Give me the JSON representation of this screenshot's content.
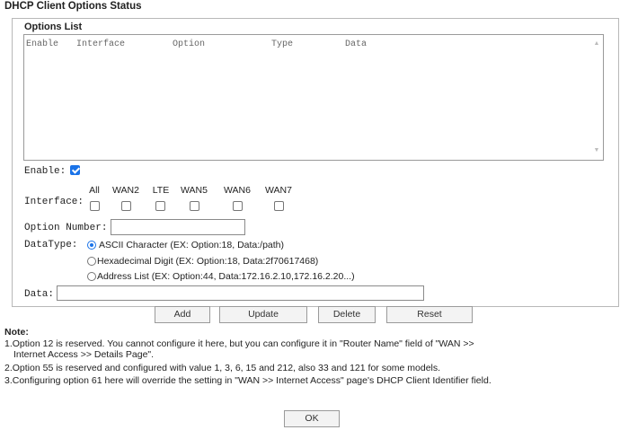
{
  "page": {
    "title": "DHCP Client Options Status"
  },
  "options_list": {
    "title": "Options List",
    "columns": [
      "Enable",
      "Interface",
      "Option",
      "Type",
      "Data"
    ]
  },
  "form": {
    "enable_label": "Enable:",
    "enable_checked": true,
    "interface_label": "Interface:",
    "interfaces": [
      "All",
      "WAN2",
      "LTE",
      "WAN5",
      "WAN6",
      "WAN7"
    ],
    "option_number_label": "Option Number:",
    "option_number_value": "",
    "datatype_label": "DataType:",
    "datatype_options": [
      {
        "label": "ASCII Character (EX: Option:18, Data:/path)",
        "selected": true
      },
      {
        "label": "Hexadecimal Digit (EX: Option:18, Data:2f70617468)",
        "selected": false
      },
      {
        "label": "Address List (EX: Option:44, Data:172.16.2.10,172.16.2.20...)",
        "selected": false
      }
    ],
    "data_label": "Data:",
    "data_value": ""
  },
  "buttons": {
    "add": "Add",
    "update": "Update",
    "delete": "Delete",
    "reset": "Reset",
    "ok": "OK"
  },
  "notes": {
    "title": "Note:",
    "lines": [
      "1.Option 12 is reserved. You cannot configure it here, but you can configure it in \"Router Name\" field of \"WAN >>",
      "Internet Access >> Details Page\".",
      "2.Option 55 is reserved and configured with value 1, 3, 6, 15 and 212, also 33 and 121 for some models.",
      "3.Configuring option 61 here will override the setting in \"WAN >> Internet Access\" page's DHCP Client Identifier field."
    ]
  },
  "colors": {
    "accent": "#1a73e8"
  }
}
